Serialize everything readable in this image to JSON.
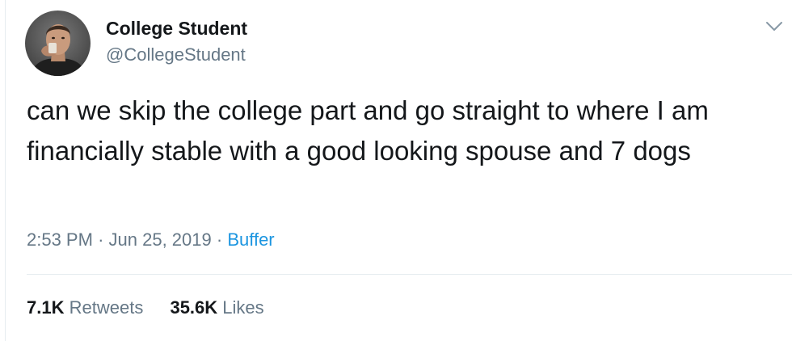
{
  "tweet": {
    "author": {
      "display_name": "College Student",
      "handle": "@CollegeStudent",
      "avatar_icon": "user-avatar-photo"
    },
    "text": "can we skip the college part and go straight to where I am financially stable with a good looking spouse and 7 dogs",
    "time": "2:53 PM",
    "date": "Jun 25, 2019",
    "separator": "·",
    "source": "Buffer",
    "stats": {
      "retweets_count": "7.1K",
      "retweets_label": "Retweets",
      "likes_count": "35.6K",
      "likes_label": "Likes"
    },
    "menu_icon": "chevron-down-icon"
  },
  "colors": {
    "text_primary": "#14171a",
    "text_secondary": "#657786",
    "link": "#1b95e0",
    "divider": "#e6ecf0"
  }
}
